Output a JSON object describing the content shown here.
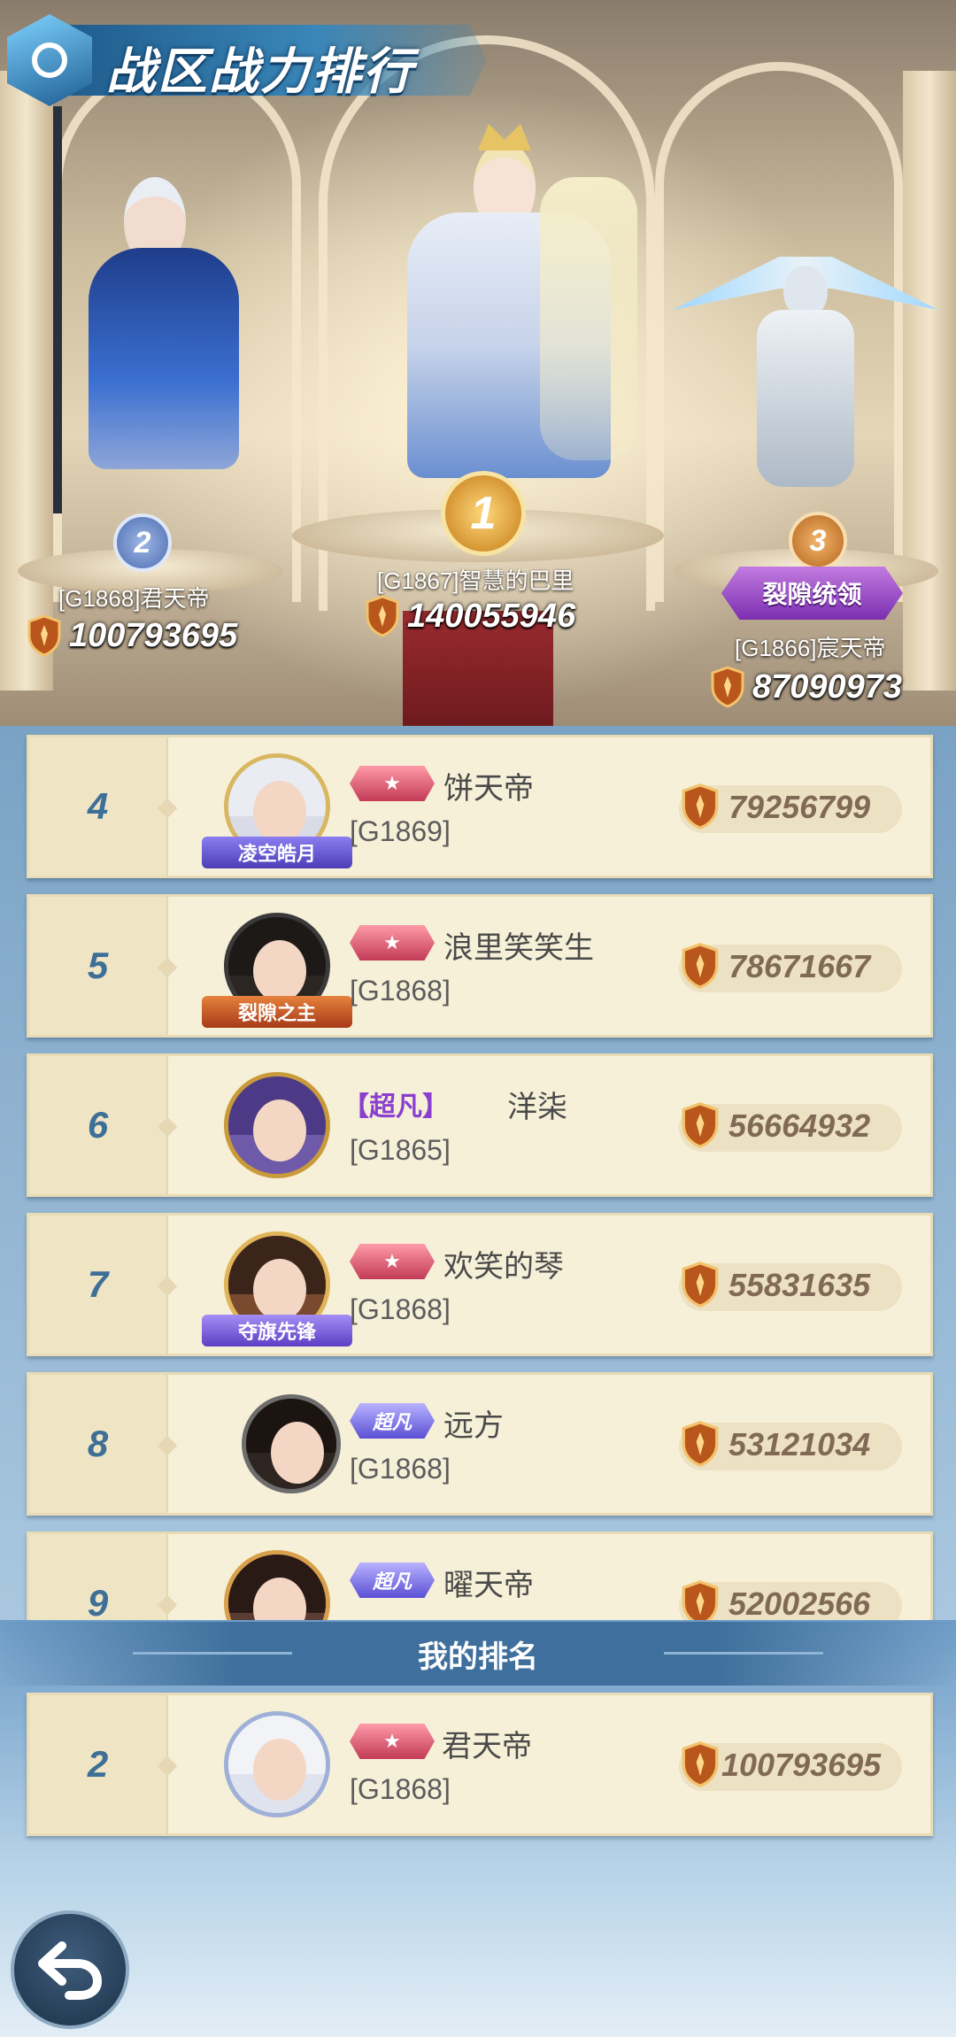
{
  "title": "战区战力排行",
  "podium": {
    "first": {
      "rank": "1",
      "name": "[G1867]智慧的巴里",
      "power": "140055946"
    },
    "second": {
      "rank": "2",
      "name": "[G1868]君天帝",
      "power": "100793695"
    },
    "third": {
      "rank": "3",
      "name": "[G1866]宸天帝",
      "power": "87090973",
      "badge": "裂隙统领"
    }
  },
  "rows": [
    {
      "rank": "4",
      "vip": "",
      "name": "饼天帝",
      "server": "[G1869]",
      "power": "79256799",
      "tag": "凌空皓月"
    },
    {
      "rank": "5",
      "vip": "",
      "name": "浪里笑笑生",
      "server": "[G1868]",
      "power": "78671667",
      "tag": "裂隙之主"
    },
    {
      "rank": "6",
      "vip": "【超凡】",
      "name": "洋柒",
      "server": "[G1865]",
      "power": "56664932",
      "tag": ""
    },
    {
      "rank": "7",
      "vip": "",
      "name": "欢笑的琴",
      "server": "[G1868]",
      "power": "55831635",
      "tag": "夺旗先锋"
    },
    {
      "rank": "8",
      "vip": "超凡",
      "name": "远方",
      "server": "[G1868]",
      "power": "53121034",
      "tag": ""
    },
    {
      "rank": "9",
      "vip": "超凡",
      "name": "曜天帝",
      "server": "",
      "power": "52002566",
      "tag": ""
    }
  ],
  "my_rank": {
    "header": "我的排名",
    "rank": "2",
    "name": "君天帝",
    "server": "[G1868]",
    "power": "100793695"
  },
  "colors": {
    "accent": "#3d6f97",
    "row_bg": "#f7f0d8",
    "power_text": "#806a55"
  },
  "icons": {
    "power": "power-shield-icon",
    "back": "back-arrow-icon"
  }
}
